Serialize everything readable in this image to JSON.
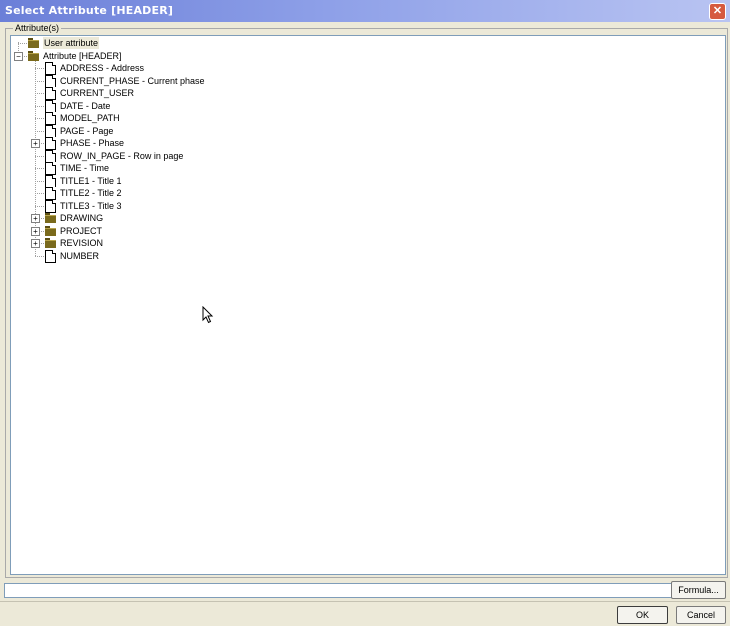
{
  "window": {
    "title": "Select Attribute [HEADER]"
  },
  "group": {
    "label": "Attribute(s)"
  },
  "tree": [
    {
      "label": "User attribute",
      "type": "folder",
      "level": 0,
      "expander": "",
      "highlight": true
    },
    {
      "label": "Attribute [HEADER]",
      "type": "folder",
      "level": 0,
      "expander": "minus",
      "highlight": false
    },
    {
      "label": "ADDRESS  - Address",
      "type": "doc",
      "level": 1,
      "expander": ""
    },
    {
      "label": "CURRENT_PHASE  - Current phase",
      "type": "doc",
      "level": 1,
      "expander": ""
    },
    {
      "label": "CURRENT_USER",
      "type": "doc",
      "level": 1,
      "expander": ""
    },
    {
      "label": "DATE  - Date",
      "type": "doc",
      "level": 1,
      "expander": ""
    },
    {
      "label": "MODEL_PATH",
      "type": "doc",
      "level": 1,
      "expander": ""
    },
    {
      "label": "PAGE  - Page",
      "type": "doc",
      "level": 1,
      "expander": ""
    },
    {
      "label": "PHASE  - Phase",
      "type": "doc",
      "level": 1,
      "expander": "plus"
    },
    {
      "label": "ROW_IN_PAGE  - Row in page",
      "type": "doc",
      "level": 1,
      "expander": ""
    },
    {
      "label": "TIME  - Time",
      "type": "doc",
      "level": 1,
      "expander": ""
    },
    {
      "label": "TITLE1  - Title 1",
      "type": "doc",
      "level": 1,
      "expander": ""
    },
    {
      "label": "TITLE2  - Title 2",
      "type": "doc",
      "level": 1,
      "expander": ""
    },
    {
      "label": "TITLE3  - Title 3",
      "type": "doc",
      "level": 1,
      "expander": ""
    },
    {
      "label": "DRAWING",
      "type": "folder",
      "level": 1,
      "expander": "plus"
    },
    {
      "label": "PROJECT",
      "type": "folder",
      "level": 1,
      "expander": "plus"
    },
    {
      "label": "REVISION",
      "type": "folder",
      "level": 1,
      "expander": "plus"
    },
    {
      "label": "NUMBER",
      "type": "doc",
      "level": 1,
      "expander": ""
    }
  ],
  "formula": {
    "value": "",
    "button_label": "Formula..."
  },
  "buttons": {
    "ok_label": "OK",
    "cancel_label": "Cancel"
  },
  "icons": {
    "close": "close-icon",
    "folder": "folder-icon",
    "doc": "document-icon",
    "cursor": "mouse-pointer-icon"
  },
  "colors": {
    "titlebar_start": "#6b7fd8",
    "titlebar_end": "#b9c4f2",
    "close_button": "#d65a3f",
    "dialog_bg": "#ece9d8"
  }
}
